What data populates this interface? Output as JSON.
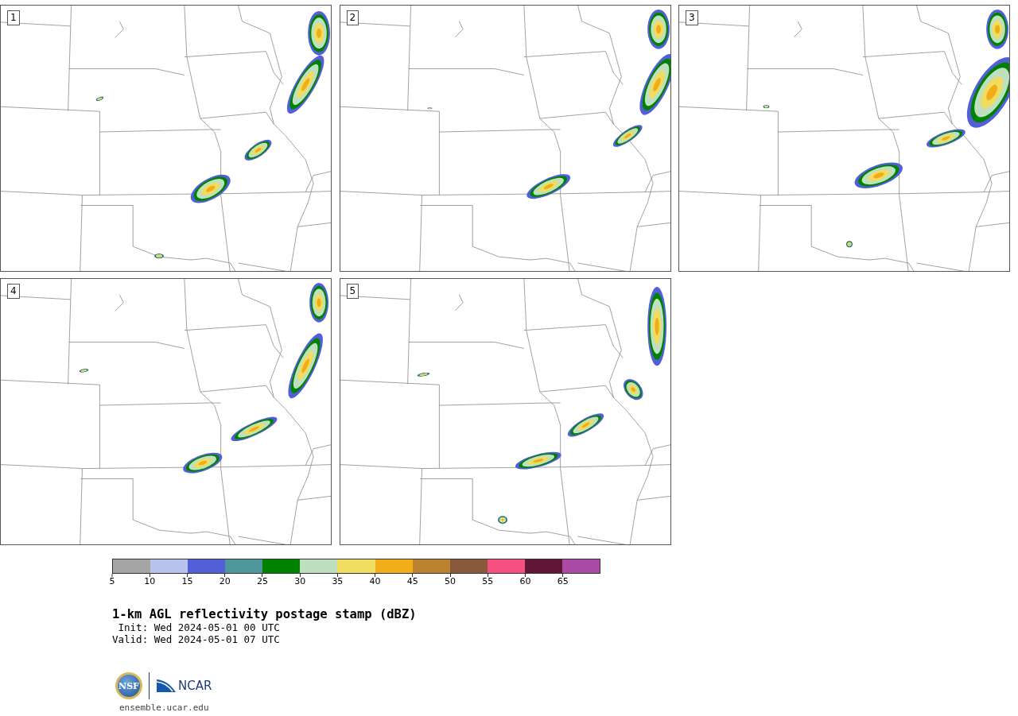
{
  "panels": [
    {
      "number": "1"
    },
    {
      "number": "2"
    },
    {
      "number": "3"
    },
    {
      "number": "4"
    },
    {
      "number": "5"
    }
  ],
  "colorbar": {
    "segments": [
      {
        "color": "#a5a5a5"
      },
      {
        "color": "#b8c3ee"
      },
      {
        "color": "#525fd8"
      },
      {
        "color": "#4f969b"
      },
      {
        "color": "#008200"
      },
      {
        "color": "#bfe0bf"
      },
      {
        "color": "#f0dc5e"
      },
      {
        "color": "#f0ad17"
      },
      {
        "color": "#bb8231"
      },
      {
        "color": "#8b5a3e"
      },
      {
        "color": "#f65080"
      },
      {
        "color": "#611636"
      },
      {
        "color": "#ac4aa7"
      }
    ],
    "ticks": [
      "5",
      "10",
      "15",
      "20",
      "25",
      "30",
      "35",
      "40",
      "45",
      "50",
      "55",
      "60",
      "65"
    ]
  },
  "title": "1-km AGL reflectivity postage stamp (dBZ)",
  "init": " Init: Wed 2024-05-01 00 UTC",
  "valid": "Valid: Wed 2024-05-01 07 UTC",
  "logo": {
    "left": "NSF",
    "right": "NCAR"
  },
  "footer_link": "ensemble.ucar.edu"
}
